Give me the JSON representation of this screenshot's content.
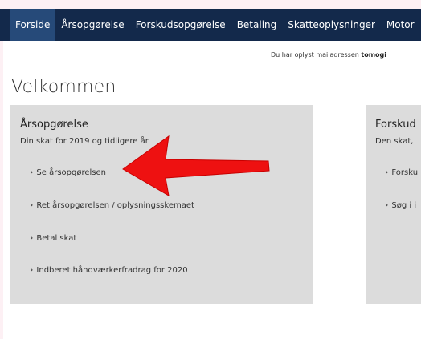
{
  "nav": {
    "items": [
      {
        "label": "Forside",
        "active": true
      },
      {
        "label": "Årsopgørelse"
      },
      {
        "label": "Forskudsopgørelse"
      },
      {
        "label": "Betaling"
      },
      {
        "label": "Skatteoplysninger"
      },
      {
        "label": "Motor"
      }
    ]
  },
  "email_note": {
    "text": "Du har oplyst mailadressen ",
    "email": "tomogi"
  },
  "page_title": "Velkommen",
  "cards": {
    "left": {
      "title": "Årsopgørelse",
      "subtitle": "Din skat for 2019 og tidligere år",
      "links": [
        "Se årsopgørelsen",
        "Ret årsopgørelsen / oplysningsskemaet",
        "Betal skat",
        "Indberet håndværkerfradrag for 2020"
      ]
    },
    "right": {
      "title": "Forskud",
      "subtitle": "Den skat,",
      "links": [
        "Forsku",
        "Søg i i"
      ]
    }
  },
  "colors": {
    "nav_bg": "#13294b",
    "nav_active": "#264a79",
    "card_bg": "#dcdcdc",
    "arrow": "#ee1111"
  }
}
